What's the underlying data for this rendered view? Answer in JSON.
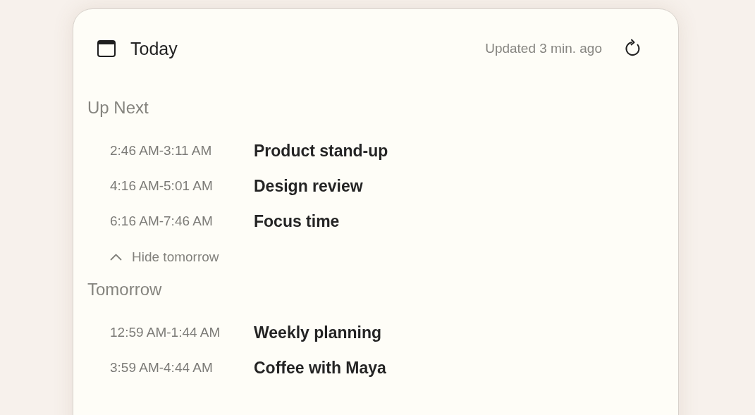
{
  "header": {
    "title": "Today",
    "updated": "Updated 3 min. ago"
  },
  "sections": [
    {
      "heading": "Up Next",
      "events": [
        {
          "time": "2:46 AM-3:11 AM",
          "title": "Product stand-up"
        },
        {
          "time": "4:16 AM-5:01 AM",
          "title": "Design review"
        },
        {
          "time": "6:16 AM-7:46 AM",
          "title": "Focus time"
        }
      ],
      "toggle": {
        "label": "Hide tomorrow",
        "expanded": true
      }
    },
    {
      "heading": "Tomorrow",
      "events": [
        {
          "time": "12:59 AM-1:44 AM",
          "title": "Weekly planning"
        },
        {
          "time": "3:59 AM-4:44 AM",
          "title": "Coffee with Maya"
        }
      ]
    }
  ]
}
